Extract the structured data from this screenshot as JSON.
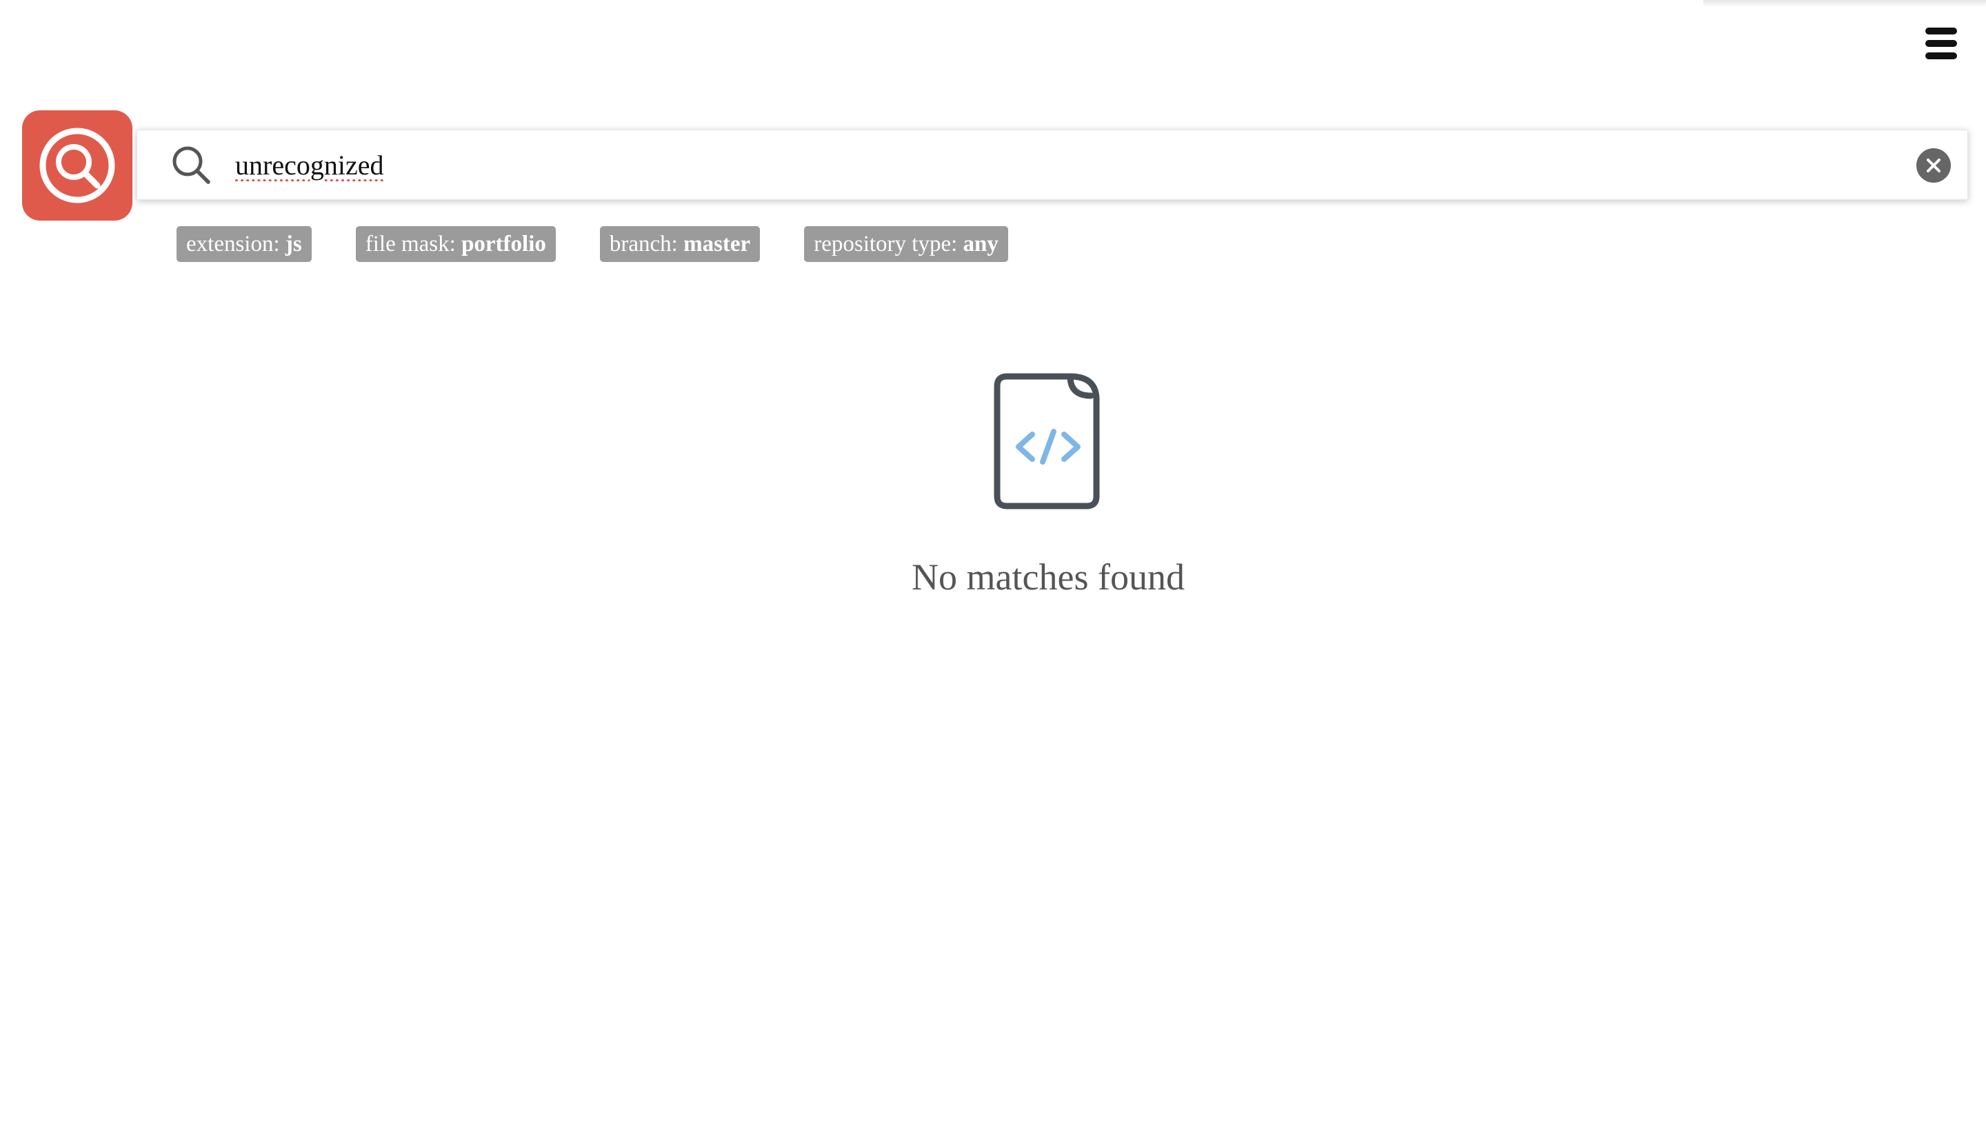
{
  "header": {
    "menu_icon": "hamburger-menu-icon"
  },
  "logo": {
    "icon": "search-logo-icon",
    "color": "#e05a4b"
  },
  "search": {
    "icon": "search-icon",
    "query": "unrecognized",
    "clear_icon": "clear-icon"
  },
  "filters": [
    {
      "label": "extension: ",
      "value": "js"
    },
    {
      "label": "file mask: ",
      "value": "portfolio"
    },
    {
      "label": "branch: ",
      "value": "master"
    },
    {
      "label": "repository type: ",
      "value": "any"
    }
  ],
  "empty_state": {
    "icon": "code-file-icon",
    "message": "No matches found"
  },
  "colors": {
    "chip_bg": "#9b9b9b",
    "code_accent": "#7eb6e8"
  }
}
